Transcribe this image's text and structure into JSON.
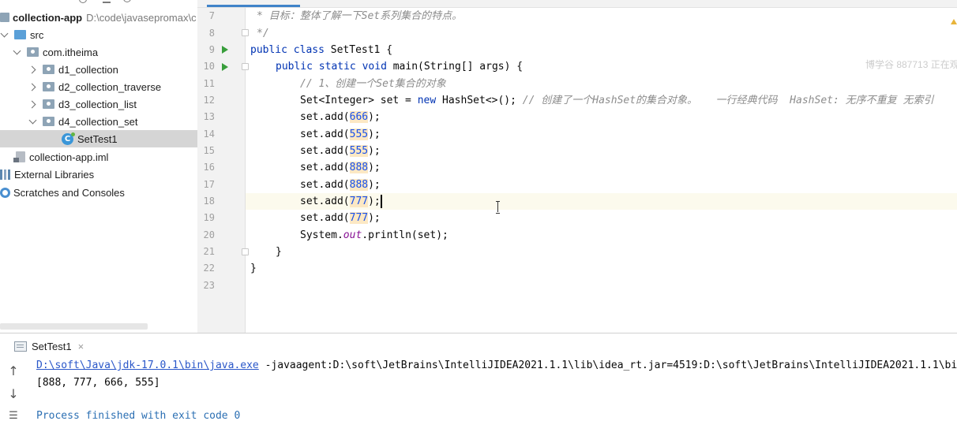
{
  "project": {
    "root": {
      "label": "collection-app",
      "path": "D:\\code\\javasepromax\\c"
    },
    "items": [
      {
        "label": "src"
      },
      {
        "label": "com.itheima"
      },
      {
        "label": "d1_collection"
      },
      {
        "label": "d2_collection_traverse"
      },
      {
        "label": "d3_collection_list"
      },
      {
        "label": "d4_collection_set"
      },
      {
        "label": "SetTest1"
      },
      {
        "label": "collection-app.iml"
      },
      {
        "label": "External Libraries"
      },
      {
        "label": "Scratches and Consoles"
      }
    ]
  },
  "editor": {
    "line_numbers": [
      "7",
      "8",
      "9",
      "10",
      "11",
      "12",
      "13",
      "14",
      "15",
      "16",
      "17",
      "18",
      "19",
      "20",
      "21",
      "22",
      "23"
    ],
    "watermark": "博学谷 887713 正在观"
  },
  "code": {
    "l7": "* 目标：整体了解一下Set系列集合的特点。",
    "l8": "*/",
    "kw_public": "public",
    "kw_class": "class",
    "class_name": " SetTest1 {",
    "kw_static": "static",
    "kw_void": "void",
    "main_sig": " main(String[] args) {",
    "l11": "// 1、创建一个Set集合的对象",
    "l12_decl": "Set<Integer> set = ",
    "kw_new": "new",
    "l12_init": " HashSet<>(); ",
    "l12_comment": "// 创建了一个HashSet的集合对象。   一行经典代码  HashSet: 无序不重复 无索引",
    "add_open": "set.add(",
    "add_close": ");",
    "values": [
      "666",
      "555",
      "555",
      "888",
      "888",
      "777",
      "777"
    ],
    "println_a": "System.",
    "println_field": "out",
    "println_b": ".println(set);",
    "close_method": "}",
    "close_class": "}"
  },
  "run": {
    "tab_label": "SetTest1",
    "close_glyph": "×",
    "java_path": "D:\\soft\\Java\\jdk-17.0.1\\bin\\java.exe",
    "java_args": " -javaagent:D:\\soft\\JetBrains\\IntelliJIDEA2021.1.1\\lib\\idea_rt.jar=4519:D:\\soft\\JetBrains\\IntelliJIDEA2021.1.1\\bi",
    "output": "[888, 777, 666, 555]",
    "process": "Process finished with exit code 0"
  },
  "icons": {
    "up": "↑",
    "down": "↓",
    "wrap": "☰"
  }
}
